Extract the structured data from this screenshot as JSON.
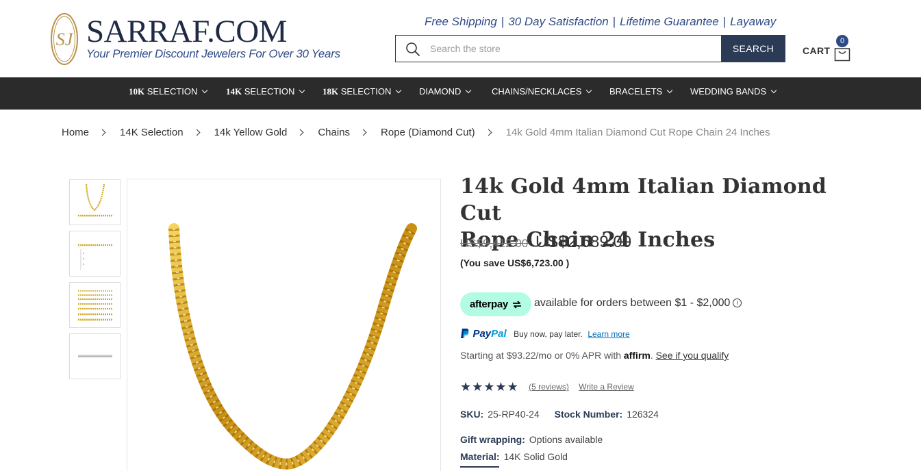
{
  "header": {
    "logo_title": "SARRAF.COM",
    "logo_tagline": "Your Premier Discount Jewelers For Over 30 Years",
    "logo_monogram": "SJ",
    "promos": [
      "Free Shipping",
      "30 Day Satisfaction",
      "Lifetime Guarantee",
      "Layaway"
    ],
    "search": {
      "placeholder": "Search the store",
      "button_label": "SEARCH"
    },
    "cart": {
      "label": "CART",
      "count": "0"
    }
  },
  "nav": {
    "items": [
      {
        "bold": "10K",
        "label": " SELECTION"
      },
      {
        "bold": "14K",
        "label": " SELECTION"
      },
      {
        "bold": "18K",
        "label": " SELECTION"
      },
      {
        "bold": "",
        "label": "DIAMOND"
      },
      {
        "bold": "",
        "label": "CHAINS/NECKLACES"
      },
      {
        "bold": "",
        "label": "BRACELETS"
      },
      {
        "bold": "",
        "label": "WEDDING BANDS"
      }
    ]
  },
  "breadcrumb": {
    "items": [
      "Home",
      "14K Selection",
      "14k Yellow Gold",
      "Chains",
      "Rope (Diamond Cut)"
    ],
    "current": "14k Gold 4mm Italian Diamond Cut Rope Chain 24 Inches"
  },
  "product": {
    "title_line1": "14k Gold 4mm Italian Diamond Cut",
    "title_line2": "Rope Chain 24 Inches",
    "price_old": "US$9,412.00",
    "price_new": "US$2,689.00",
    "savings": "(You save US$6,723.00 )",
    "afterpay": {
      "logo": "afterpay",
      "text": "available for orders between $1 - $2,000"
    },
    "paypal": {
      "logo_pay": "Pay",
      "logo_pal": "Pal",
      "text": "Buy now, pay later.",
      "link": "Learn more"
    },
    "affirm": {
      "text": "Starting at $93.22/mo or 0% APR with",
      "logo": "affirm",
      "link": "See if you qualify"
    },
    "rating": {
      "stars": 5,
      "reviews_label": "(5 reviews)",
      "write_review": "Write a Review"
    },
    "sku_label": "SKU:",
    "sku": "25-RP40-24",
    "stock_label": "Stock Number:",
    "stock": "126324",
    "gift_label": "Gift wrapping:",
    "gift": "Options available",
    "material_label": "Material:",
    "material": "14K Solid Gold"
  },
  "colors": {
    "brand_navy": "#1f2a44",
    "brand_blue": "#2f4b87",
    "nav_bg": "#2b2b2b",
    "search_button": "#2b3a55",
    "afterpay_mint": "#b2fce4",
    "gold": "#d4a82b"
  }
}
